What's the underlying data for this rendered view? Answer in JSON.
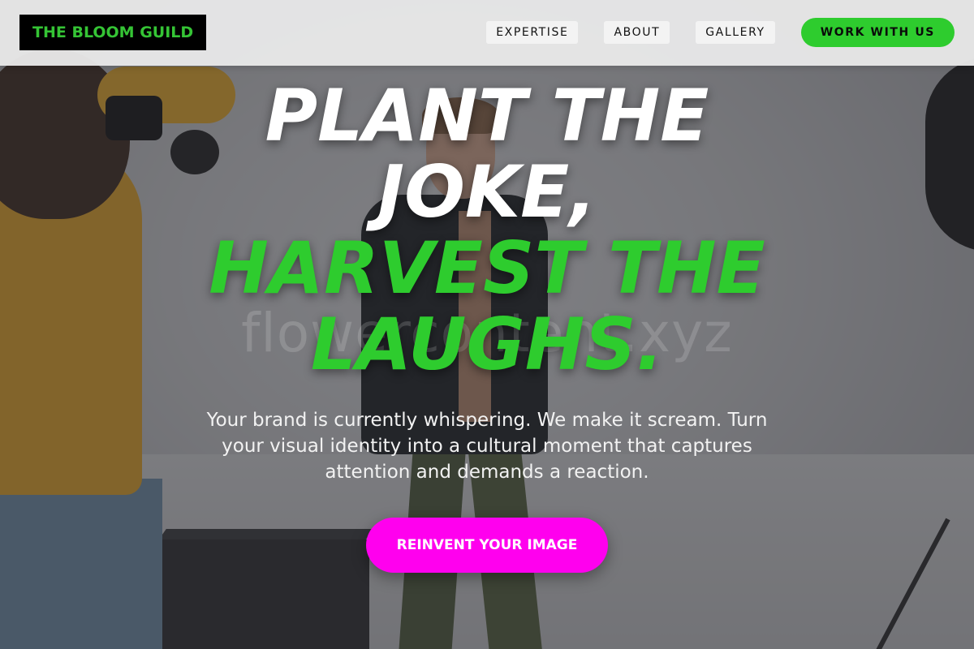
{
  "header": {
    "logo_text": "THE BLOOM GUILD",
    "nav": [
      {
        "label": "EXPERTISE"
      },
      {
        "label": "ABOUT"
      },
      {
        "label": "GALLERY"
      }
    ],
    "cta_label": "WORK WITH US"
  },
  "hero": {
    "headline_line1": "PLANT THE JOKE,",
    "headline_line2": "HARVEST THE LAUGHS.",
    "subtext": "Your brand is currently whispering. We make it scream. Turn your visual identity into a cultural moment that captures attention and demands a reaction.",
    "cta_label": "REINVENT YOUR IMAGE",
    "watermark": "flowercontent.xyz"
  },
  "colors": {
    "accent_green": "#2ecc2e",
    "accent_magenta": "#ff00ee",
    "logo_bg": "#000000",
    "header_bg": "#e8e8e8"
  }
}
